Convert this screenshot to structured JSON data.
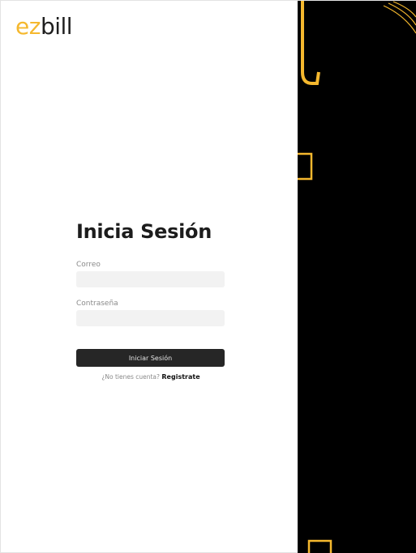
{
  "brand": {
    "logo_part_1": "ez",
    "logo_part_2": "bill"
  },
  "login": {
    "title": "Inicia Sesión",
    "email_label": "Correo",
    "email_value": "",
    "password_label": "Contraseña",
    "password_value": "",
    "submit_label": "Iniciar Sesión",
    "signup_prompt": "¿No tienes cuenta?",
    "signup_link": "Registrate"
  },
  "colors": {
    "accent": "#f5b82e",
    "dark_panel": "#000000",
    "button": "#262626",
    "input_background": "#f2f2f2"
  }
}
